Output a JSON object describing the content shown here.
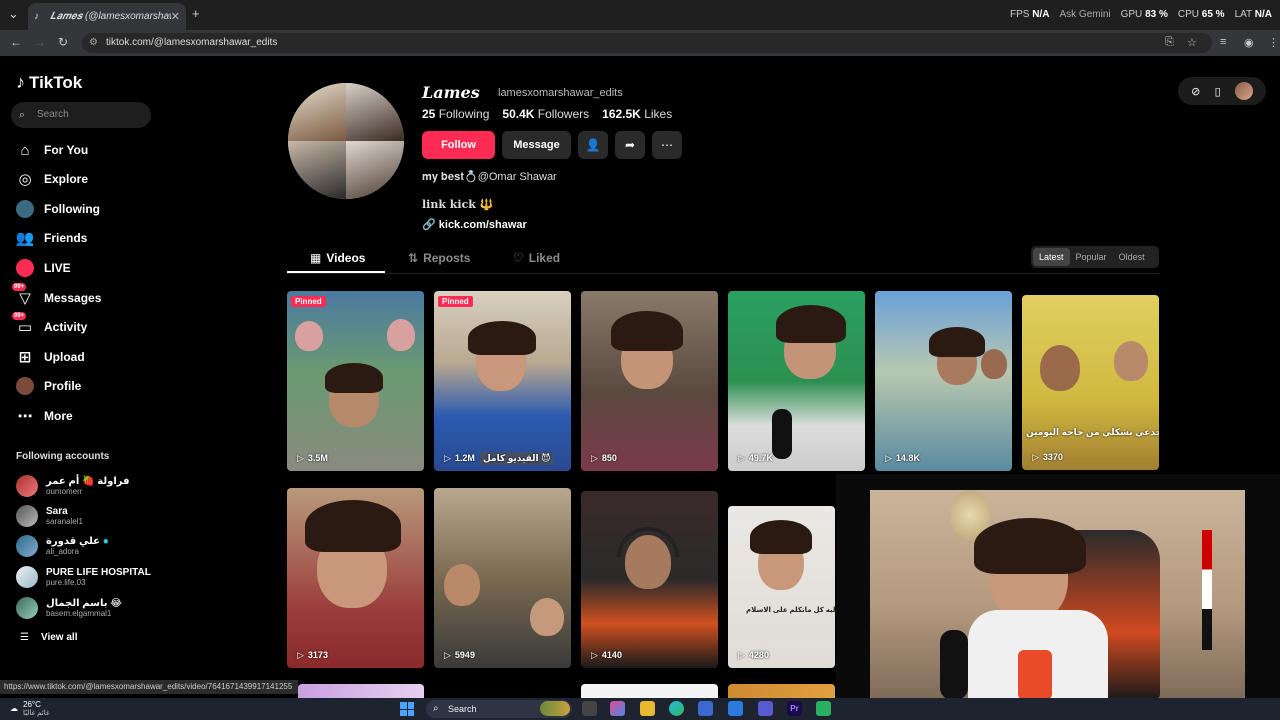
{
  "browser": {
    "tab_title": "𝑳𝒂𝒎𝒆𝒔 (@lamesxomarshawar_",
    "tab_close": "✕",
    "new_tab": "+",
    "url": "tiktok.com/@lamesxomarshawar_edits",
    "perf": {
      "fps_label": "FPS",
      "fps_value": "N/A",
      "gpu_label": "GPU",
      "gpu_value": "83 %",
      "cpu_label": "CPU",
      "cpu_value": "65 %",
      "lat_label": "LAT",
      "lat_value": "N/A",
      "ask_gemini": "Ask Gemini"
    },
    "status_url": "https://www.tiktok.com/@lamesxomarshawar_edits/video/7641671439917141255"
  },
  "sidebar": {
    "logo": "TikTok",
    "search_placeholder": "Search",
    "items": [
      {
        "label": "For You",
        "icon": "home-icon"
      },
      {
        "label": "Explore",
        "icon": "compass-icon"
      },
      {
        "label": "Following",
        "icon": "following-avatar-icon"
      },
      {
        "label": "Friends",
        "icon": "friends-icon"
      },
      {
        "label": "LIVE",
        "icon": "live-icon"
      },
      {
        "label": "Messages",
        "icon": "messages-icon",
        "badge": "99+"
      },
      {
        "label": "Activity",
        "icon": "activity-icon",
        "badge": "99+"
      },
      {
        "label": "Upload",
        "icon": "upload-icon"
      },
      {
        "label": "Profile",
        "icon": "profile-avatar-icon"
      },
      {
        "label": "More",
        "icon": "more-icon"
      }
    ],
    "following_title": "Following accounts",
    "accounts": [
      {
        "name": "فراولة 🍓 أم عمر",
        "handle": "oumomerr"
      },
      {
        "name": "Sara",
        "handle": "saranalel1"
      },
      {
        "name": "علي قدورة",
        "handle": "ali_adora"
      },
      {
        "name": "PURE LIFE HOSPITAL",
        "handle": "pure.life.03"
      },
      {
        "name": "باسم الجمال 😂",
        "handle": "basem.elgammal1"
      }
    ],
    "view_all": "View all"
  },
  "profile": {
    "name": "𝑳𝒂𝒎𝒆𝒔",
    "handle": "lamesxomarshawar_edits",
    "following_count": "25",
    "following_label": "Following",
    "followers_count": "50.4K",
    "followers_label": "Followers",
    "likes_count": "162.5K",
    "likes_label": "Likes",
    "follow_label": "Follow",
    "message_label": "Message",
    "bio_line1": "𝐦𝐲 𝐛𝐞𝐬𝐭💍@Omar Shawar",
    "bio_line2": "link kick",
    "bio_emoji": "🔱",
    "link": "kick.com/shawar"
  },
  "tabs": [
    {
      "label": "Videos",
      "icon": "grid-icon"
    },
    {
      "label": "Reposts",
      "icon": "repost-icon"
    },
    {
      "label": "Liked",
      "icon": "heart-icon"
    }
  ],
  "sort": [
    "Latest",
    "Popular",
    "Oldest"
  ],
  "videos": [
    {
      "views": "3.5M",
      "pinned": "Pinned"
    },
    {
      "views": "1.2M",
      "pinned": "Pinned",
      "caption": "الفيديو كامل 😈"
    },
    {
      "views": "850"
    },
    {
      "views": "49.7K"
    },
    {
      "views": "14.8K"
    },
    {
      "views": "3370",
      "caption": "جدعي بشكلي من حاجة اليومين"
    },
    {
      "views": "3173"
    },
    {
      "views": "5949"
    },
    {
      "views": "4140"
    },
    {
      "views": "4280",
      "caption": "ليه كل ماتكلم على الاسلام"
    }
  ],
  "taskbar": {
    "temp": "26°C",
    "weather_sub": "غائم غالبًا",
    "search": "Search"
  },
  "colors": {
    "accent": "#fe2c55",
    "bg": "#000000"
  }
}
